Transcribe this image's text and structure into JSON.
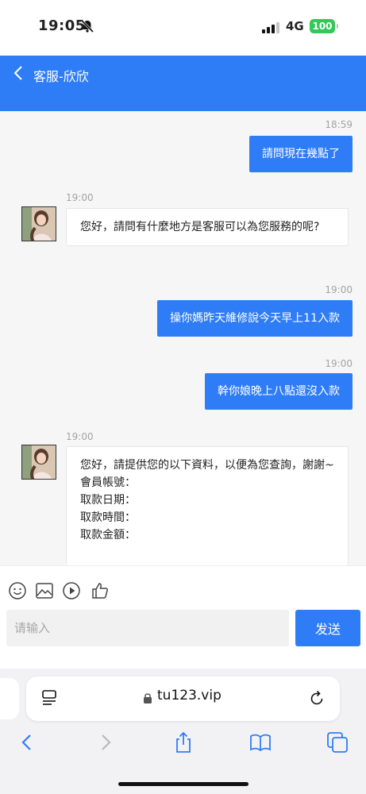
{
  "status_bar": {
    "time": "19:05",
    "network": "4G",
    "battery": "100"
  },
  "header": {
    "title": "客服-欣欣"
  },
  "messages": [
    {
      "direction": "out",
      "time": "18:59",
      "text": "請問現在幾點了"
    },
    {
      "direction": "in",
      "time": "19:00",
      "text": "您好，請問有什麼地方是客服可以為您服務的呢?"
    },
    {
      "direction": "out",
      "time": "19:00",
      "text": "操你媽昨天維修說今天早上11入款"
    },
    {
      "direction": "out",
      "time": "19:00",
      "text": "幹你娘晚上八點還沒入款"
    },
    {
      "direction": "in",
      "time": "19:00",
      "lines": [
        "您好，請提供您的以下資料，以便為您查詢，謝謝~",
        "會員帳號：",
        "取款日期：",
        "取款時間：",
        "取款金額："
      ]
    }
  ],
  "composer": {
    "placeholder": "请输入",
    "send_label": "发送",
    "tools": [
      "emoji-icon",
      "image-icon",
      "video-icon",
      "thumbs-up-icon"
    ]
  },
  "browser": {
    "url": "tu123.vip"
  },
  "colors": {
    "accent": "#2f7df6",
    "chat_background": "#f6f6f7",
    "battery": "#34c759"
  }
}
